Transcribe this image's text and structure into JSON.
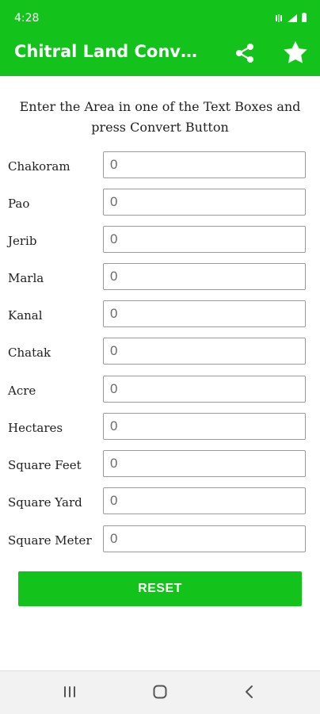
{
  "status": {
    "time": "4:28"
  },
  "app": {
    "title": "Chitral Land Converter..."
  },
  "instructions": "Enter the Area in one of the Text Boxes and press Convert Button",
  "fields": [
    {
      "label": "Chakoram",
      "value": "",
      "placeholder": "0"
    },
    {
      "label": "Pao",
      "value": "",
      "placeholder": "0"
    },
    {
      "label": "Jerib",
      "value": "",
      "placeholder": "0"
    },
    {
      "label": "Marla",
      "value": "",
      "placeholder": "0"
    },
    {
      "label": "Kanal",
      "value": "",
      "placeholder": "0"
    },
    {
      "label": "Chatak",
      "value": "",
      "placeholder": "0"
    },
    {
      "label": "Acre",
      "value": "",
      "placeholder": "0"
    },
    {
      "label": "Hectares",
      "value": "",
      "placeholder": "0"
    },
    {
      "label": "Square Feet",
      "value": "",
      "placeholder": "0"
    },
    {
      "label": "Square Yard",
      "value": "",
      "placeholder": "0"
    },
    {
      "label": "Square Meter",
      "value": "",
      "placeholder": "0"
    }
  ],
  "actions": {
    "reset_label": "RESET"
  },
  "icons": {
    "share": "share-icon",
    "star": "star-icon",
    "recents": "recents-icon",
    "home": "home-icon",
    "back": "back-icon"
  },
  "colors": {
    "primary": "#14c21c",
    "text": "#1f1f1f",
    "border": "#9b9b9b"
  }
}
